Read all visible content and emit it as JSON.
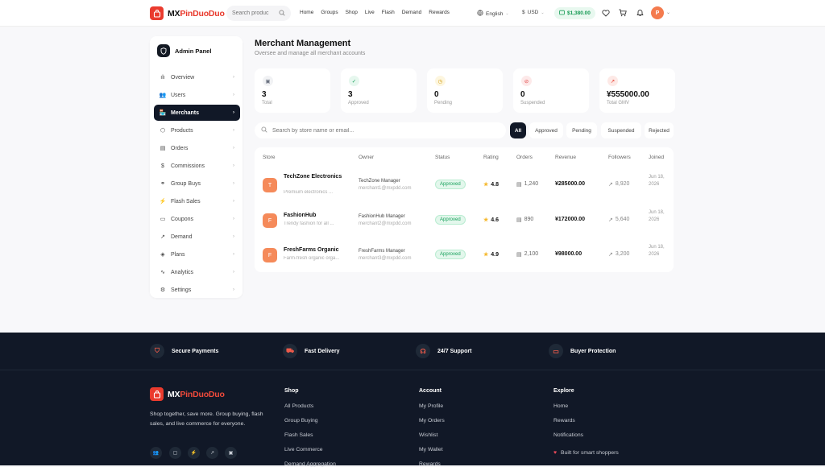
{
  "header": {
    "logo_letter": "🛍",
    "brand_mx": "MX",
    "brand_pdd": "PinDuoDuo",
    "search_placeholder": "Search produc",
    "nav": [
      "Home",
      "Groups",
      "Shop",
      "Live",
      "Flash",
      "Demand",
      "Rewards"
    ],
    "language": "English",
    "currency": "USD",
    "wallet": "$1,380.00",
    "avatar": "P"
  },
  "sidebar": {
    "title": "Admin Panel",
    "items": [
      {
        "label": "Overview",
        "icon": "bar-chart-icon",
        "glyph": "ılı"
      },
      {
        "label": "Users",
        "icon": "users-icon",
        "glyph": "👥"
      },
      {
        "label": "Merchants",
        "icon": "store-icon",
        "glyph": "🏪",
        "active": true
      },
      {
        "label": "Products",
        "icon": "package-icon",
        "glyph": "⬡"
      },
      {
        "label": "Orders",
        "icon": "box-icon",
        "glyph": "▤"
      },
      {
        "label": "Commissions",
        "icon": "dollar-icon",
        "glyph": "$"
      },
      {
        "label": "Group Buys",
        "icon": "link-icon",
        "glyph": "⚭"
      },
      {
        "label": "Flash Sales",
        "icon": "lightning-icon",
        "glyph": "⚡"
      },
      {
        "label": "Coupons",
        "icon": "ticket-icon",
        "glyph": "▭"
      },
      {
        "label": "Demand",
        "icon": "trend-icon",
        "glyph": "↗"
      },
      {
        "label": "Plans",
        "icon": "layers-icon",
        "glyph": "◈"
      },
      {
        "label": "Analytics",
        "icon": "activity-icon",
        "glyph": "∿"
      },
      {
        "label": "Settings",
        "icon": "gear-icon",
        "glyph": "⚙"
      }
    ]
  },
  "main": {
    "title": "Merchant Management",
    "subtitle": "Oversee and manage all merchant accounts",
    "stats": [
      {
        "value": "3",
        "label": "Total",
        "color": "#6b7280",
        "bg": "#f1f2f4",
        "glyph": "▣"
      },
      {
        "value": "3",
        "label": "Approved",
        "color": "#16a05a",
        "bg": "#e6f7ee",
        "glyph": "✓"
      },
      {
        "value": "0",
        "label": "Pending",
        "color": "#d4a017",
        "bg": "#fdf6df",
        "glyph": "◷"
      },
      {
        "value": "0",
        "label": "Suspended",
        "color": "#e14a4a",
        "bg": "#fde9e9",
        "glyph": "⊘"
      },
      {
        "value": "¥555000.00",
        "label": "Total GMV",
        "color": "#e8392c",
        "bg": "#fde9e6",
        "glyph": "↗"
      }
    ],
    "search_placeholder": "Search by store name or email...",
    "filters": [
      "All",
      "Approved",
      "Pending",
      "Suspended",
      "Rejected"
    ],
    "table": {
      "headers": [
        "Store",
        "Owner",
        "Status",
        "Rating",
        "Orders",
        "Revenue",
        "Followers",
        "Joined"
      ],
      "rows": [
        {
          "initial": "T",
          "name": "TechZone Electronics",
          "desc": "Premium electronics ...",
          "owner": "TechZone Manager",
          "email": "merchant1@mxpdd.com",
          "status": "Approved",
          "rating": "4.8",
          "orders": "1,240",
          "revenue": "¥285000.00",
          "followers": "8,920",
          "joined": "Jun 18, 2026"
        },
        {
          "initial": "F",
          "name": "FashionHub",
          "desc": "Trendy fashion for all ...",
          "owner": "FashionHub Manager",
          "email": "merchant2@mxpdd.com",
          "status": "Approved",
          "rating": "4.6",
          "orders": "890",
          "revenue": "¥172000.00",
          "followers": "5,640",
          "joined": "Jun 18, 2026"
        },
        {
          "initial": "F",
          "name": "FreshFarms Organic",
          "desc": "Farm-fresh organic orga...",
          "owner": "FreshFarms Manager",
          "email": "merchant3@mxpdd.com",
          "status": "Approved",
          "rating": "4.9",
          "orders": "2,100",
          "revenue": "¥98000.00",
          "followers": "3,200",
          "joined": "Jun 18, 2026"
        }
      ]
    }
  },
  "footer": {
    "features": [
      "Secure Payments",
      "Fast Delivery",
      "24/7 Support",
      "Buyer Protection"
    ],
    "description": "Shop together, save more. Group buying, flash sales, and live commerce for everyone.",
    "columns": [
      {
        "heading": "Shop",
        "items": [
          "All Products",
          "Group Buying",
          "Flash Sales",
          "Live Commerce",
          "Demand Aggregation"
        ]
      },
      {
        "heading": "Account",
        "items": [
          "My Profile",
          "My Orders",
          "Wishlist",
          "My Wallet",
          "Rewards"
        ]
      },
      {
        "heading": "Explore",
        "items": [
          "Home",
          "Rewards",
          "Notifications"
        ]
      }
    ],
    "built": "Built for smart shoppers"
  }
}
